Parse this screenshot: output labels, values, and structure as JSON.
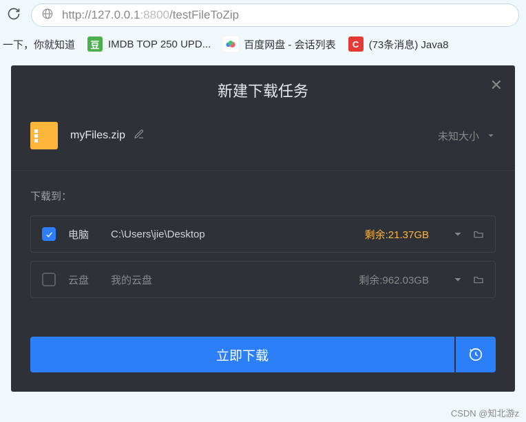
{
  "url": {
    "protocol": "http://",
    "host": "127.0.0.1",
    "port": ":8800",
    "path": "/testFileToZip"
  },
  "bookmarks": {
    "hint": "一下，你就知道",
    "imdb": "IMDB TOP 250 UPD...",
    "baidu": "百度网盘 - 会话列表",
    "csdn": "(73条消息) Java8"
  },
  "modal": {
    "title": "新建下载任务",
    "fileName": "myFiles.zip",
    "fileSize": "未知大小",
    "downloadToLabel": "下载到：",
    "dest1": {
      "name": "电脑",
      "path": "C:\\Users\\jie\\Desktop",
      "remain": "剩余:21.37GB"
    },
    "dest2": {
      "name": "云盘",
      "path": "我的云盘",
      "remain": "剩余:962.03GB"
    },
    "downloadBtn": "立即下载"
  },
  "watermark": "CSDN @知北游z"
}
